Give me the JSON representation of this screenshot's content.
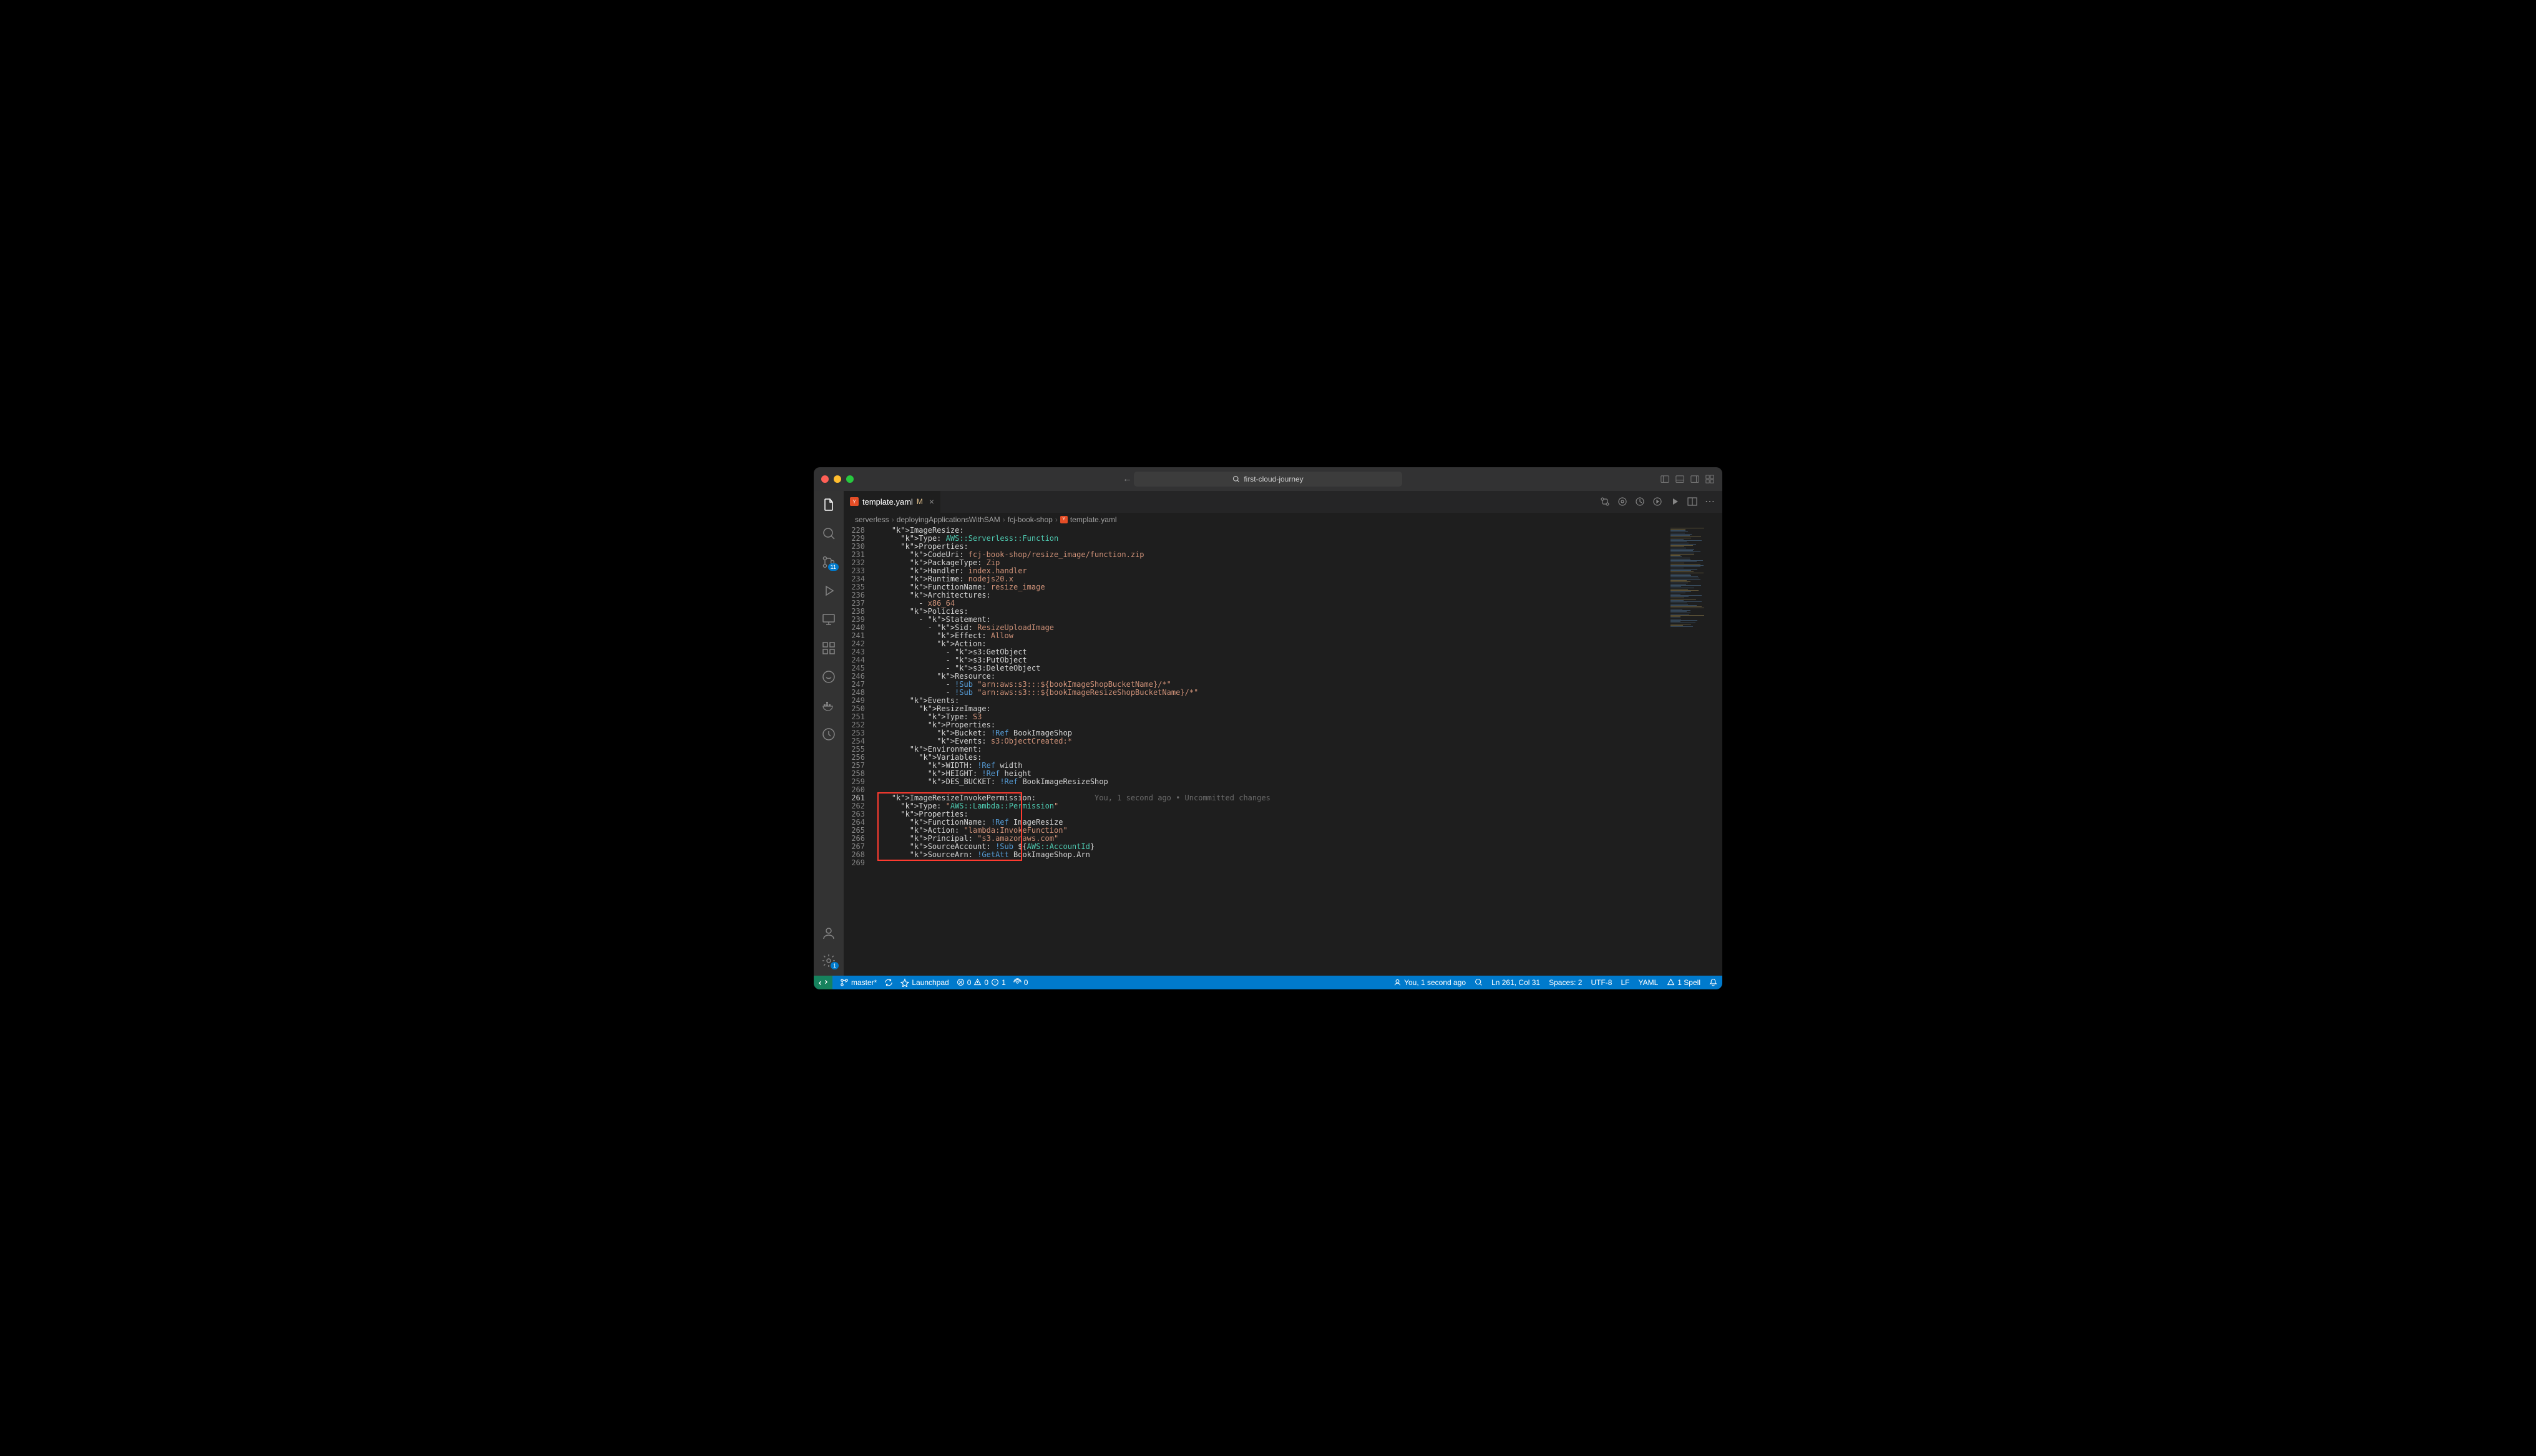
{
  "titlebar": {
    "url": "first-cloud-journey"
  },
  "tab": {
    "name": "template.yaml",
    "modified": "M"
  },
  "breadcrumb": {
    "parts": [
      "serverless",
      "deployingApplicationsWithSAM",
      "fcj-book-shop",
      "template.yaml"
    ]
  },
  "gitlens": {
    "annotation": "You, 1 second ago • Uncommitted changes"
  },
  "lines": [
    {
      "n": 228,
      "code": "    ImageResize:"
    },
    {
      "n": 229,
      "code": "      Type: AWS::Serverless::Function"
    },
    {
      "n": 230,
      "code": "      Properties:"
    },
    {
      "n": 231,
      "code": "        CodeUri: fcj-book-shop/resize_image/function.zip"
    },
    {
      "n": 232,
      "code": "        PackageType: Zip"
    },
    {
      "n": 233,
      "code": "        Handler: index.handler"
    },
    {
      "n": 234,
      "code": "        Runtime: nodejs20.x"
    },
    {
      "n": 235,
      "code": "        FunctionName: resize_image"
    },
    {
      "n": 236,
      "code": "        Architectures:"
    },
    {
      "n": 237,
      "code": "          - x86_64"
    },
    {
      "n": 238,
      "code": "        Policies:"
    },
    {
      "n": 239,
      "code": "          - Statement:"
    },
    {
      "n": 240,
      "code": "            - Sid: ResizeUploadImage"
    },
    {
      "n": 241,
      "code": "              Effect: Allow"
    },
    {
      "n": 242,
      "code": "              Action:"
    },
    {
      "n": 243,
      "code": "                - s3:GetObject"
    },
    {
      "n": 244,
      "code": "                - s3:PutObject"
    },
    {
      "n": 245,
      "code": "                - s3:DeleteObject"
    },
    {
      "n": 246,
      "code": "              Resource:"
    },
    {
      "n": 247,
      "code": "                - !Sub \"arn:aws:s3:::${bookImageShopBucketName}/*\""
    },
    {
      "n": 248,
      "code": "                - !Sub \"arn:aws:s3:::${bookImageResizeShopBucketName}/*\""
    },
    {
      "n": 249,
      "code": "        Events:"
    },
    {
      "n": 250,
      "code": "          ResizeImage:"
    },
    {
      "n": 251,
      "code": "            Type: S3"
    },
    {
      "n": 252,
      "code": "            Properties:"
    },
    {
      "n": 253,
      "code": "              Bucket: !Ref BookImageShop"
    },
    {
      "n": 254,
      "code": "              Events: s3:ObjectCreated:*"
    },
    {
      "n": 255,
      "code": "        Environment:"
    },
    {
      "n": 256,
      "code": "          Variables:"
    },
    {
      "n": 257,
      "code": "            WIDTH: !Ref width"
    },
    {
      "n": 258,
      "code": "            HEIGHT: !Ref height"
    },
    {
      "n": 259,
      "code": "            DES_BUCKET: !Ref BookImageResizeShop"
    },
    {
      "n": 260,
      "code": ""
    },
    {
      "n": 261,
      "code": "    ImageResizeInvokePermission:",
      "hl": true
    },
    {
      "n": 262,
      "code": "      Type: \"AWS::Lambda::Permission\""
    },
    {
      "n": 263,
      "code": "      Properties:"
    },
    {
      "n": 264,
      "code": "        FunctionName: !Ref ImageResize"
    },
    {
      "n": 265,
      "code": "        Action: \"lambda:InvokeFunction\""
    },
    {
      "n": 266,
      "code": "        Principal: \"s3.amazonaws.com\""
    },
    {
      "n": 267,
      "code": "        SourceAccount: !Sub ${AWS::AccountId}"
    },
    {
      "n": 268,
      "code": "        SourceArn: !GetAtt BookImageShop.Arn"
    },
    {
      "n": 269,
      "code": ""
    }
  ],
  "statusbar": {
    "branch": "master*",
    "launchpad": "Launchpad",
    "problems": "0",
    "warnings": "0",
    "port": "0",
    "gitlens": "You, 1 second ago",
    "cursor": "Ln 261, Col 31",
    "spaces": "Spaces: 2",
    "encoding": "UTF-8",
    "eol": "LF",
    "lang": "YAML",
    "spell": "1 Spell",
    "scm_badge": "11",
    "settings_badge": "1",
    "errors_triangle": "1"
  }
}
